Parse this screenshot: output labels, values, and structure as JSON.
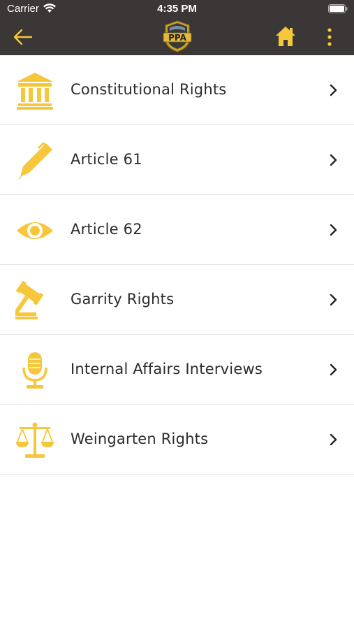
{
  "status_bar": {
    "carrier": "Carrier",
    "time": "4:35 PM"
  },
  "nav": {
    "logo_text": "PPA",
    "icons": {
      "back": "arrow-left-icon",
      "logo": "ppa-badge-logo",
      "home": "home-icon",
      "more": "vertical-dots-icon"
    }
  },
  "colors": {
    "accent": "#f7c73b",
    "header_bg": "#3a3736",
    "text": "#2b2b2b",
    "divider": "#e6e6e6"
  },
  "menu": {
    "items": [
      {
        "label": "Constitutional Rights",
        "icon": "courthouse-icon"
      },
      {
        "label": "Article 61",
        "icon": "pen-icon"
      },
      {
        "label": "Article 62",
        "icon": "eye-icon"
      },
      {
        "label": "Garrity Rights",
        "icon": "gavel-icon"
      },
      {
        "label": "Internal Affairs Interviews",
        "icon": "microphone-icon"
      },
      {
        "label": "Weingarten Rights",
        "icon": "scales-icon"
      }
    ]
  }
}
